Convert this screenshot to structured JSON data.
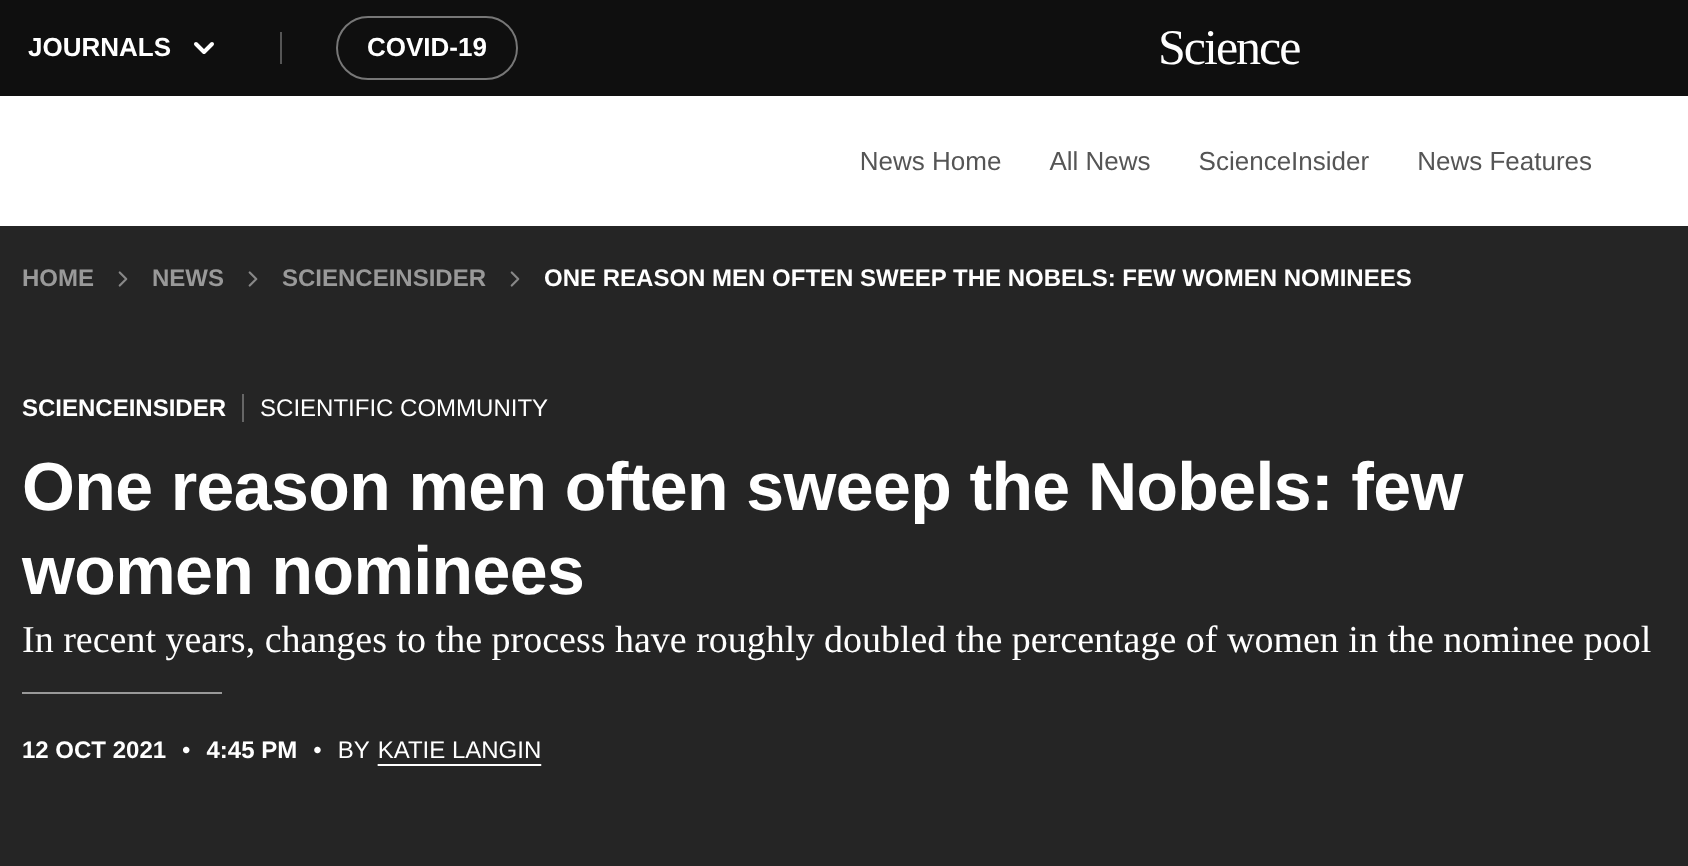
{
  "top_bar": {
    "journals_menu": "JOURNALS",
    "covid_button": "COVID-19",
    "logo": "Science"
  },
  "news_nav": [
    "News Home",
    "All News",
    "ScienceInsider",
    "News Features"
  ],
  "breadcrumbs": [
    {
      "label": "HOME",
      "selected": false
    },
    {
      "label": "NEWS",
      "selected": false
    },
    {
      "label": "SCIENCEINSIDER",
      "selected": false
    },
    {
      "label": "ONE REASON MEN OFTEN SWEEP THE NOBELS: FEW WOMEN NOMINEES",
      "selected": true
    }
  ],
  "article": {
    "section": "SCIENCEINSIDER",
    "topic": "SCIENTIFIC COMMUNITY",
    "title": "One reason men often sweep the Nobels: few women nominees",
    "subtitle": "In recent years, changes to the process have roughly doubled the percentage of women in the nominee pool",
    "byline": {
      "date": "12 OCT 2021",
      "separator_1": "•",
      "time": "4:45 PM",
      "separator_2": "•",
      "by": "BY",
      "author": "KATIE LANGIN"
    }
  }
}
